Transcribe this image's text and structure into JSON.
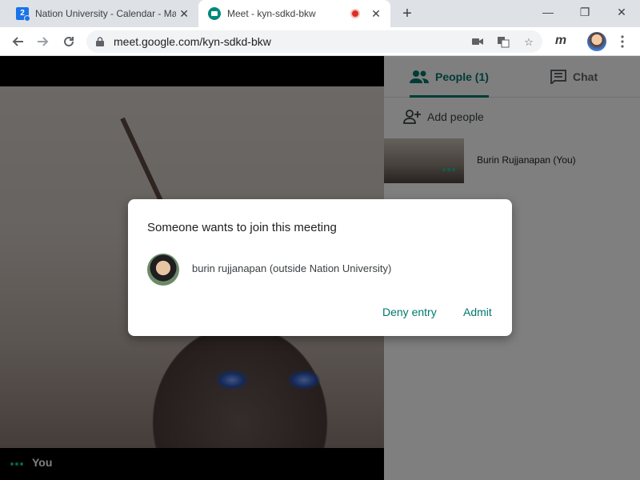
{
  "browser": {
    "tabs": [
      {
        "title": "Nation University - Calendar - Ma",
        "favicon": "calendar-icon"
      },
      {
        "title": "Meet - kyn-sdkd-bkw",
        "favicon": "meet-icon",
        "recording": true
      }
    ],
    "calendar_badge": "2",
    "window_controls": {
      "minimize": "—",
      "maximize": "❐",
      "close": "✕"
    },
    "url": "meet.google.com/kyn-sdkd-bkw",
    "extension_label": "m"
  },
  "video": {
    "self_label": "You"
  },
  "panel": {
    "tabs": {
      "people": "People (1)",
      "chat": "Chat"
    },
    "add_people": "Add people",
    "participants": [
      {
        "name": "Burin Rujjanapan (You)"
      }
    ]
  },
  "dialog": {
    "title": "Someone wants to join this meeting",
    "requester": "burin rujjanapan (outside Nation University)",
    "deny_label": "Deny entry",
    "admit_label": "Admit"
  },
  "colors": {
    "accent": "#00796b",
    "tab_strip": "#dee1e6",
    "recording": "#d93025",
    "scrim": "rgba(0,0,0,0.5)"
  }
}
